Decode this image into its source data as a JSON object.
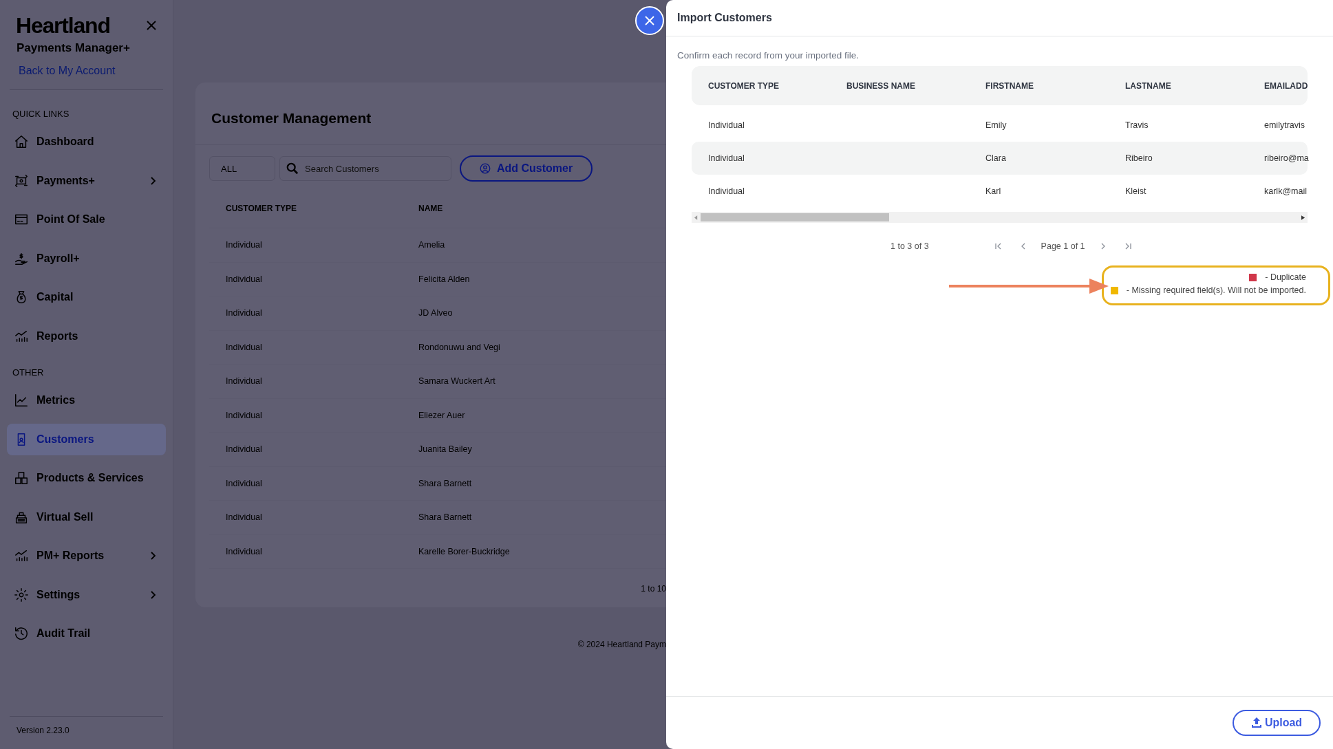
{
  "sidebar": {
    "brand": "Heartland",
    "subtitle": "Payments Manager+",
    "back_link": "Back to My Account",
    "sections": [
      {
        "heading": "QUICK LINKS",
        "items": [
          {
            "label": "Dashboard",
            "submenu": false,
            "selected": false
          },
          {
            "label": "Payments+",
            "submenu": true,
            "selected": false
          },
          {
            "label": "Point Of Sale",
            "submenu": false,
            "selected": false
          },
          {
            "label": "Payroll+",
            "submenu": false,
            "selected": false
          },
          {
            "label": "Capital",
            "submenu": false,
            "selected": false
          },
          {
            "label": "Reports",
            "submenu": false,
            "selected": false
          }
        ]
      },
      {
        "heading": "OTHER",
        "items": [
          {
            "label": "Metrics",
            "submenu": false,
            "selected": false
          },
          {
            "label": "Customers",
            "submenu": false,
            "selected": true
          },
          {
            "label": "Products & Services",
            "submenu": false,
            "selected": false
          },
          {
            "label": "Virtual Sell",
            "submenu": false,
            "selected": false
          },
          {
            "label": "PM+ Reports",
            "submenu": true,
            "selected": false
          },
          {
            "label": "Settings",
            "submenu": true,
            "selected": false
          },
          {
            "label": "Audit Trail",
            "submenu": false,
            "selected": false
          }
        ]
      }
    ],
    "version": "Version 2.23.0"
  },
  "page": {
    "title": "Customer Management",
    "filter": "ALL",
    "search": {
      "placeholder": "Search Customers"
    },
    "add_button": "Add Customer",
    "table": {
      "columns": [
        "CUSTOMER TYPE",
        "NAME"
      ],
      "rows": [
        [
          "Individual",
          "Amelia"
        ],
        [
          "Individual",
          "Felicita Alden"
        ],
        [
          "Individual",
          "JD Alveo"
        ],
        [
          "Individual",
          "Rondonuwu and Vegi"
        ],
        [
          "Individual",
          "Samara Wuckert Art"
        ],
        [
          "Individual",
          "Eliezer Auer"
        ],
        [
          "Individual",
          "Juanita Bailey"
        ],
        [
          "Individual",
          "Shara Barnett"
        ],
        [
          "Individual",
          "Shara Barnett"
        ],
        [
          "Individual",
          "Karelle Borer-Buckridge"
        ]
      ]
    },
    "pagination": "1 to 10",
    "footer": "© 2024 Heartland Paym"
  },
  "modal": {
    "title": "Import Customers",
    "instruction": "Confirm each record from your imported file.",
    "table": {
      "columns": [
        "CUSTOMER TYPE",
        "BUSINESS NAME",
        "FIRSTNAME",
        "LASTNAME",
        "EMAILADD"
      ],
      "rows": [
        [
          "Individual",
          "",
          "Emily",
          "Travis",
          "emilytravis"
        ],
        [
          "Individual",
          "",
          "Clara",
          "Ribeiro",
          "ribeiro@ma"
        ],
        [
          "Individual",
          "",
          "Karl",
          "Kleist",
          "karlk@mail"
        ]
      ]
    },
    "pagination": {
      "summary": "1 to 3 of 3",
      "page": "Page 1 of 1"
    },
    "legend": [
      {
        "color": "#d0374a",
        "label": "- Duplicate"
      },
      {
        "color": "#f0b800",
        "label": "- Missing required field(s). Will not be imported."
      }
    ],
    "upload_button": "Upload"
  }
}
